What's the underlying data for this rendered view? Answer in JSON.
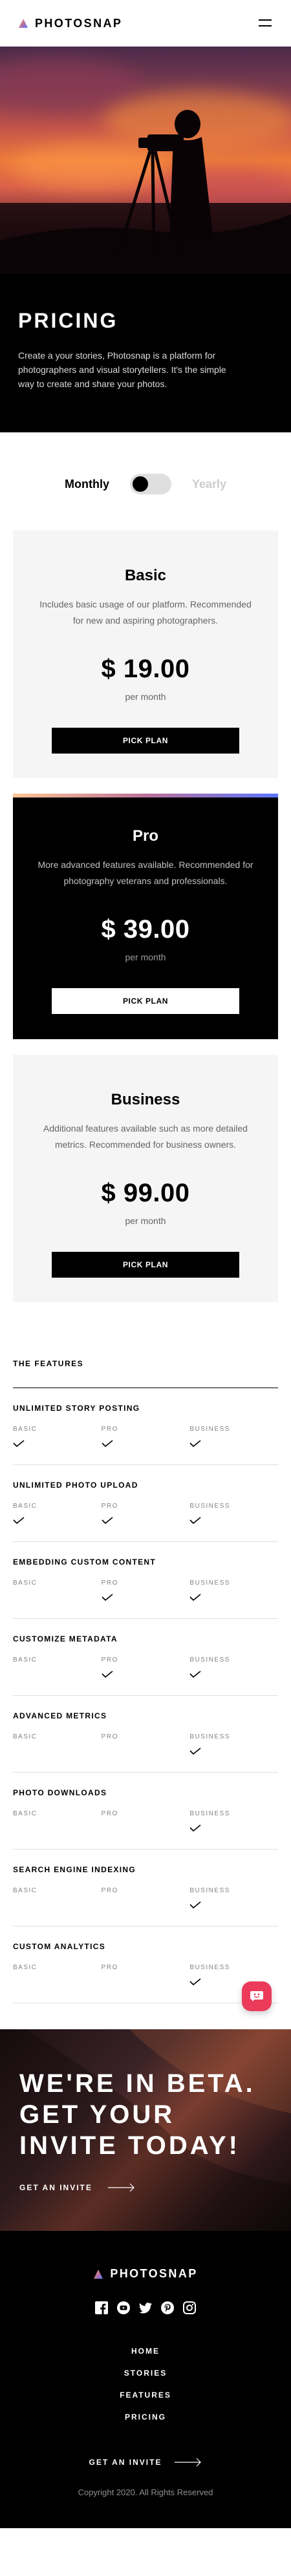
{
  "header": {
    "brand": "PHOTOSNAP",
    "menu_icon": "hamburger-menu-icon"
  },
  "hero": {
    "title": "PRICING",
    "description": "Create a your stories, Photosnap is a platform for photographers and visual storytellers. It's the simple way to create and share your photos."
  },
  "billing_toggle": {
    "monthly_label": "Monthly",
    "yearly_label": "Yearly",
    "selected": "Monthly"
  },
  "plans": [
    {
      "name": "Basic",
      "description": "Includes basic usage of our platform. Recommended for new and aspiring photographers.",
      "price": "$ 19.00",
      "period": "per month",
      "button": "PICK PLAN"
    },
    {
      "name": "Pro",
      "description": "More advanced features available. Recommended for photography veterans and professionals.",
      "price": "$ 39.00",
      "period": "per month",
      "button": "PICK PLAN"
    },
    {
      "name": "Business",
      "description": "Additional features available such as more detailed metrics. Recommended for business owners.",
      "price": "$ 99.00",
      "period": "per month",
      "button": "PICK PLAN"
    }
  ],
  "features": {
    "heading": "THE FEATURES",
    "tier_labels": [
      "BASIC",
      "PRO",
      "BUSINESS"
    ],
    "items": [
      {
        "name": "UNLIMITED STORY POSTING",
        "basic": true,
        "pro": true,
        "business": true
      },
      {
        "name": "UNLIMITED PHOTO UPLOAD",
        "basic": true,
        "pro": true,
        "business": true
      },
      {
        "name": "EMBEDDING CUSTOM CONTENT",
        "basic": false,
        "pro": true,
        "business": true
      },
      {
        "name": "CUSTOMIZE METADATA",
        "basic": false,
        "pro": true,
        "business": true
      },
      {
        "name": "ADVANCED METRICS",
        "basic": false,
        "pro": false,
        "business": true
      },
      {
        "name": "PHOTO DOWNLOADS",
        "basic": false,
        "pro": false,
        "business": true
      },
      {
        "name": "SEARCH ENGINE INDEXING",
        "basic": false,
        "pro": false,
        "business": true
      },
      {
        "name": "CUSTOM ANALYTICS",
        "basic": false,
        "pro": false,
        "business": true
      }
    ]
  },
  "beta": {
    "title": "WE'RE IN BETA. GET YOUR INVITE TODAY!",
    "cta": "GET AN INVITE"
  },
  "footer": {
    "brand": "PHOTOSNAP",
    "socials": [
      "facebook-icon",
      "youtube-icon",
      "twitter-icon",
      "pinterest-icon",
      "instagram-icon"
    ],
    "nav": [
      "HOME",
      "STORIES",
      "FEATURES",
      "PRICING"
    ],
    "cta": "GET AN INVITE",
    "copyright": "Copyright 2020. All Rights Reserved"
  },
  "colors": {
    "accent_gradient": [
      "#ffc593",
      "#bc7198",
      "#5a77ff"
    ],
    "chat_button": "#ec3a5b"
  }
}
